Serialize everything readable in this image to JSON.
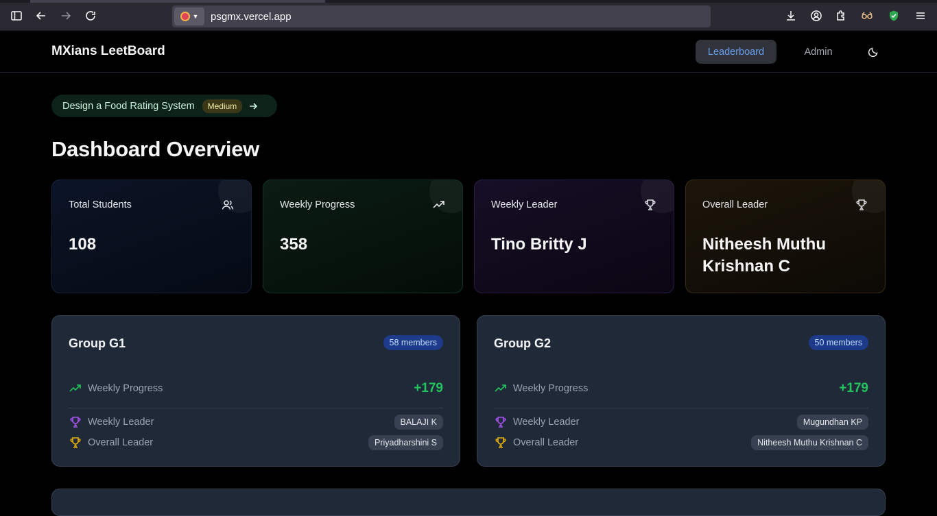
{
  "browser": {
    "url": "psgmx.vercel.app"
  },
  "header": {
    "brand": "MXians LeetBoard",
    "nav_leaderboard": "Leaderboard",
    "nav_admin": "Admin",
    "theme_icon": "moon-icon"
  },
  "problem": {
    "title": "Design a Food Rating System",
    "difficulty": "Medium"
  },
  "page_title": "Dashboard Overview",
  "stats": [
    {
      "label": "Total Students",
      "value": "108",
      "icon": "users-icon"
    },
    {
      "label": "Weekly Progress",
      "value": "358",
      "icon": "trending-up-icon"
    },
    {
      "label": "Weekly Leader",
      "value": "Tino Britty J",
      "icon": "trophy-icon"
    },
    {
      "label": "Overall Leader",
      "value": "Nitheesh Muthu Krishnan C",
      "icon": "trophy-icon"
    }
  ],
  "groups": [
    {
      "name": "Group G1",
      "members": "58 members",
      "progress_label": "Weekly Progress",
      "progress_value": "+179",
      "weekly_leader_label": "Weekly Leader",
      "weekly_leader": "BALAJI K",
      "overall_leader_label": "Overall Leader",
      "overall_leader": "Priyadharshini S"
    },
    {
      "name": "Group G2",
      "members": "50 members",
      "progress_label": "Weekly Progress",
      "progress_value": "+179",
      "weekly_leader_label": "Weekly Leader",
      "weekly_leader": "Mugundhan KP",
      "overall_leader_label": "Overall Leader",
      "overall_leader": "Nitheesh Muthu Krishnan C"
    }
  ],
  "colors": {
    "accent_blue": "#6aa0f2",
    "progress_green": "#22c55e",
    "trophy_purple": "#a855f7",
    "trophy_gold": "#eab308"
  }
}
